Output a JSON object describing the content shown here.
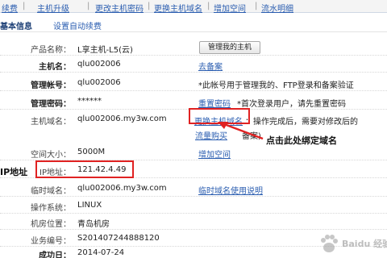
{
  "tabs": [
    "续费",
    "主机升级",
    "更改主机密码",
    "更换主机域名",
    "增加空间",
    "流水明细"
  ],
  "subtabs": {
    "active": "基本信息",
    "link": "设置自动续费"
  },
  "rows": {
    "product": {
      "label": "产品名称：",
      "value": "L享主机-L5(云)",
      "button": "管理我的主机"
    },
    "hostname": {
      "label": "主机名：",
      "value": "qlu002006",
      "link": "去备案"
    },
    "account": {
      "label": "管理帐号：",
      "value": "qlu002006",
      "note": "*此帐号用于管理我的、FTP登录和备案验证"
    },
    "password": {
      "label": "管理密码：",
      "value": "******",
      "link": "重置密码",
      "note": "*首次登录用户，请先重置密码"
    },
    "domain": {
      "label": "主机域名：",
      "value": "qlu002006.my3w.com",
      "link": "更换主机域名",
      "note": "：操作完成后，需要对修改后的",
      "link2": "流量购买",
      "note2": "备案)"
    },
    "space": {
      "label": "空间大小：",
      "value": "5000M",
      "link": "增加空间"
    },
    "ip": {
      "label": "IP地址：",
      "value": "121.42.4.49"
    },
    "tempdomain": {
      "label": "临时域名：",
      "value": "qlu002006.my3w.com",
      "link": "临时域名使用说明"
    },
    "os": {
      "label": "操作系统：",
      "value": "LINUX"
    },
    "location": {
      "label": "机房位置：",
      "value": "青岛机房"
    },
    "bizno": {
      "label": "业务编号：",
      "value": "S201407244888120"
    },
    "success": {
      "label": "成功日：",
      "value": "2014-07-24"
    }
  },
  "annotations": {
    "bind_domain": "点击此处绑定域名",
    "ip_side": "IP地址"
  },
  "watermark": {
    "text": "Baidu 经验"
  },
  "colors": {
    "highlight": "#e02222",
    "link": "#2a5db0"
  }
}
